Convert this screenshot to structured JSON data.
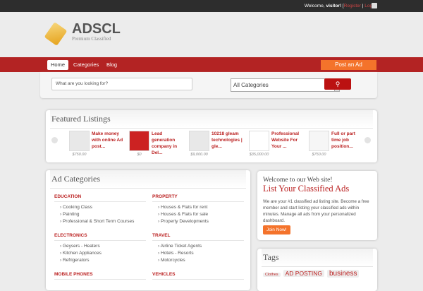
{
  "topbar": {
    "welcome": "Welcome, ",
    "user": "visitor!",
    "register": "Register",
    "login": "Login"
  },
  "logo": {
    "title": "ADSCL",
    "subtitle": "Premium Classified"
  },
  "nav": {
    "items": [
      "Home",
      "Categories",
      "Blog"
    ],
    "post_ad": "Post an Ad"
  },
  "search": {
    "placeholder": "What are you looking for?",
    "category": "All Categories",
    "button_icon": "search-icon"
  },
  "featured": {
    "title": "Featured Listings",
    "items": [
      {
        "title": "Make money with online Ad post...",
        "price": "$750.00"
      },
      {
        "title": "Lead generation company in Del...",
        "price": "$0"
      },
      {
        "title": "10218 gleam technologies | gle...",
        "price": "$9,000.00"
      },
      {
        "title": "Professional Website For Your ...",
        "price": "$35,000.00"
      },
      {
        "title": "Full or part time job position...",
        "price": "$750.00"
      }
    ]
  },
  "categories": {
    "title": "Ad Categories",
    "left": [
      {
        "name": "EDUCATION",
        "items": [
          "Cooking Class",
          "Painting",
          "Professional & Short Term Courses"
        ]
      },
      {
        "name": "ELECTRONICS",
        "items": [
          "Geysers - Heaters",
          "Kitchen Appliances",
          "Refrigerators"
        ]
      },
      {
        "name": "MOBILE PHONES",
        "items": []
      }
    ],
    "right": [
      {
        "name": "PROPERTY",
        "items": [
          "Houses & Flats for rent",
          "Houses & Flats for sale",
          "Property Developments"
        ]
      },
      {
        "name": "TRAVEL",
        "items": [
          "Airline Ticket Agents",
          "Hotels - Resorts",
          "Motorcycles"
        ]
      },
      {
        "name": "VEHICLES",
        "items": []
      }
    ]
  },
  "welcome": {
    "title": "Welcome to our Web site!",
    "subtitle": "List Your Classified Ads",
    "text": "We are your #1 classified ad listing site. Become a free member and start listing your classified ads within minutes. Manage all ads from your personalized dashboard.",
    "join": "Join Now!"
  },
  "tags": {
    "title": "Tags",
    "items": [
      "Clothes",
      "AD POSTING",
      "business"
    ]
  },
  "colors": {
    "accent": "#b32323",
    "orange": "#f4732b"
  }
}
